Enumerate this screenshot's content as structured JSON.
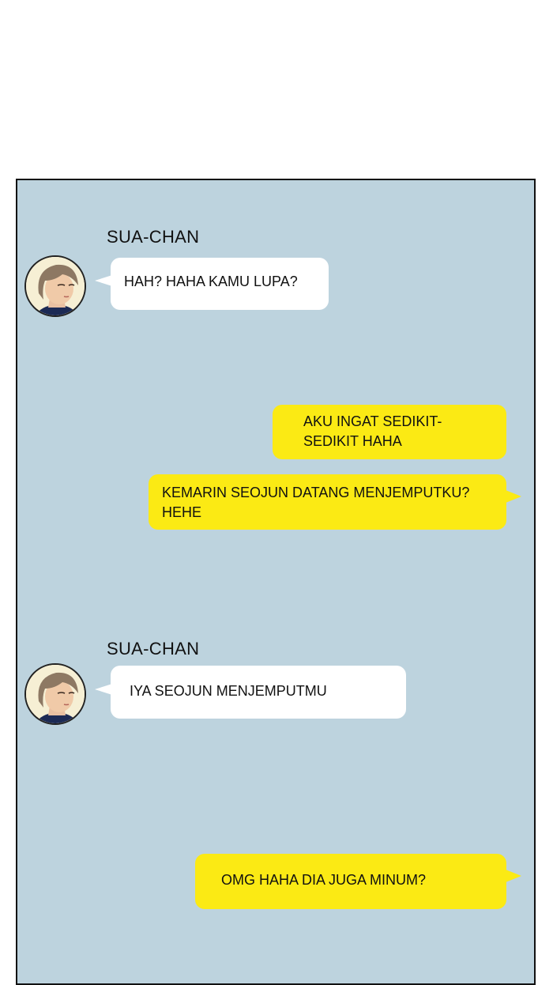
{
  "messages": [
    {
      "sender": "SUA-CHAN",
      "text": "HAH? HAHA KAMU LUPA?"
    },
    {
      "lines": [
        "AKU INGAT SEDIKIT-",
        "SEDIKIT HAHA"
      ]
    },
    {
      "lines": [
        "KEMARIN SEOJUN DATANG MENJEMPUTKU?",
        "HEHE"
      ]
    },
    {
      "sender": "SUA-CHAN",
      "text": "IYA SEOJUN MENJEMPUTMU"
    },
    {
      "lines": [
        "OMG HAHA DIA JUGA MINUM?"
      ]
    }
  ],
  "colors": {
    "panel_background": "#bdd3de",
    "incoming_bubble": "#ffffff",
    "outgoing_bubble": "#fbea14"
  }
}
